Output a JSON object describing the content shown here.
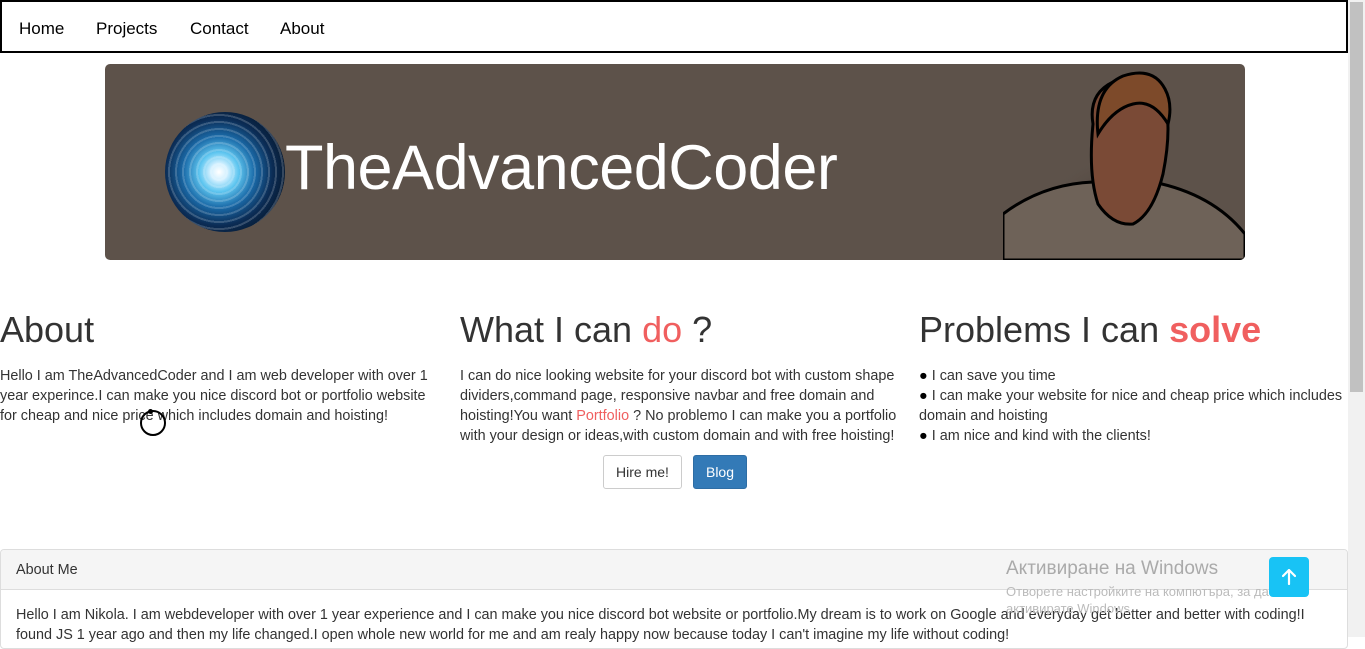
{
  "nav": {
    "items": [
      {
        "label": "Home"
      },
      {
        "label": "Projects"
      },
      {
        "label": "Contact"
      },
      {
        "label": "About"
      }
    ]
  },
  "banner": {
    "title": "TheAdvancedCoder"
  },
  "about": {
    "heading": "About",
    "text": "Hello I am TheAdvancedCoder and I am web developer with over 1 year experince.I can make you nice discord bot or portfolio website for cheap and nice price which includes domain and hoisting!"
  },
  "what": {
    "heading_pre": "What I can ",
    "heading_accent": "do",
    "heading_post": " ?",
    "text_pre": "I can do nice looking website for your discord bot with custom shape dividers,command page, responsive navbar and free domain and hoisting!You want ",
    "link": "Portfolio",
    "text_post": " ? No problemo I can make you a portfolio with your design or ideas,with custom domain and with free hoisting!"
  },
  "problems": {
    "heading_pre": "Problems I can ",
    "heading_accent": "solve",
    "bullet": "●",
    "items": [
      "I can save you time",
      "I can make your website for nice and cheap price which includes domain and hoisting",
      "I am nice and kind with the clients!"
    ]
  },
  "buttons": {
    "hire": "Hire me!",
    "blog": "Blog"
  },
  "panel": {
    "heading": "About Me",
    "body": "Hello I am Nikola. I am webdeveloper with over 1 year experience and I can make you nice discord bot website or portfolio.My dream is to work on Google and everyday get better and better with coding!I found JS 1 year ago and then my life changed.I open whole new world for me and am realy happy now because today I can't imagine my life without coding!"
  },
  "watermark": {
    "title": "Активиране на Windows",
    "subtitle_line1": "Отворете настройките на компютъра, за да",
    "subtitle_line2": "активирате Windows."
  },
  "colors": {
    "accent": "#f05f5f",
    "banner_bg": "#5d524a",
    "primary_button": "#337ab7",
    "to_top": "#18c3f5"
  },
  "icons": {
    "to_top": "arrow-up-icon"
  }
}
